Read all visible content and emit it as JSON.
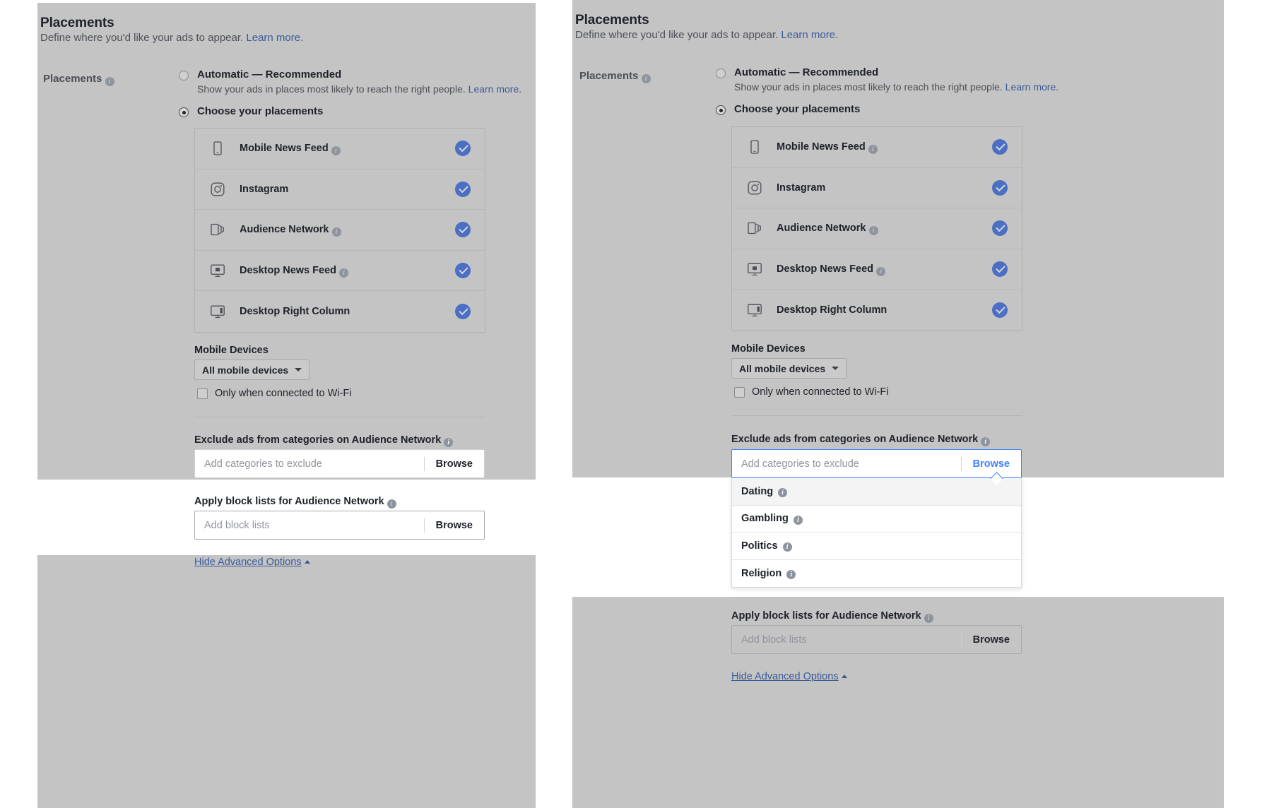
{
  "panels": [
    {
      "id": "left",
      "header": {
        "title": "Placements",
        "subtitle_prefix": "Define where you'd like your ads to appear. ",
        "subtitle_link": "Learn more",
        "subtitle_suffix": "."
      },
      "side_label": "Placements",
      "options": {
        "automatic": {
          "title": "Automatic — Recommended",
          "desc_prefix": "Show your ads in places most likely to reach the right people. ",
          "desc_link": "Learn more",
          "desc_suffix": ".",
          "selected": false
        },
        "choose": {
          "title": "Choose your placements",
          "selected": true
        }
      },
      "placements": [
        {
          "label": "Mobile News Feed",
          "icon": "mobile-phone-icon",
          "info": true,
          "checked": true
        },
        {
          "label": "Instagram",
          "icon": "instagram-icon",
          "info": false,
          "checked": true
        },
        {
          "label": "Audience Network",
          "icon": "audience-network-icon",
          "info": true,
          "checked": true
        },
        {
          "label": "Desktop News Feed",
          "icon": "desktop-monitor-icon",
          "info": true,
          "checked": true
        },
        {
          "label": "Desktop Right Column",
          "icon": "desktop-right-column-icon",
          "info": false,
          "checked": true
        }
      ],
      "mobile_devices": {
        "title": "Mobile Devices",
        "select_value": "All mobile devices",
        "wifi_label": "Only when connected to Wi-Fi",
        "wifi_checked": false
      },
      "exclude": {
        "title": "Exclude ads from categories on Audience Network",
        "placeholder": "Add categories to exclude",
        "value": "",
        "browse_label": "Browse",
        "focused": false,
        "menu_open": false
      },
      "block_lists": {
        "title": "Apply block lists for Audience Network",
        "placeholder": "Add block lists",
        "value": "",
        "browse_label": "Browse"
      },
      "advanced_link": "Hide Advanced Options"
    },
    {
      "id": "right",
      "header": {
        "title": "Placements",
        "subtitle_prefix": "Define where you'd like your ads to appear. ",
        "subtitle_link": "Learn more",
        "subtitle_suffix": "."
      },
      "side_label": "Placements",
      "options": {
        "automatic": {
          "title": "Automatic — Recommended",
          "desc_prefix": "Show your ads in places most likely to reach the right people. ",
          "desc_link": "Learn more",
          "desc_suffix": ".",
          "selected": false
        },
        "choose": {
          "title": "Choose your placements",
          "selected": true
        }
      },
      "placements": [
        {
          "label": "Mobile News Feed",
          "icon": "mobile-phone-icon",
          "info": true,
          "checked": true
        },
        {
          "label": "Instagram",
          "icon": "instagram-icon",
          "info": false,
          "checked": true
        },
        {
          "label": "Audience Network",
          "icon": "audience-network-icon",
          "info": true,
          "checked": true
        },
        {
          "label": "Desktop News Feed",
          "icon": "desktop-monitor-icon",
          "info": true,
          "checked": true
        },
        {
          "label": "Desktop Right Column",
          "icon": "desktop-right-column-icon",
          "info": false,
          "checked": true
        }
      ],
      "mobile_devices": {
        "title": "Mobile Devices",
        "select_value": "All mobile devices",
        "wifi_label": "Only when connected to Wi-Fi",
        "wifi_checked": false
      },
      "exclude": {
        "title": "Exclude ads from categories on Audience Network",
        "placeholder": "Add categories to exclude",
        "value": "",
        "browse_label": "Browse",
        "focused": true,
        "menu_open": true,
        "menu_items": [
          {
            "label": "Dating",
            "info": true,
            "highlighted": true
          },
          {
            "label": "Gambling",
            "info": true,
            "highlighted": false
          },
          {
            "label": "Politics",
            "info": true,
            "highlighted": false
          },
          {
            "label": "Religion",
            "info": true,
            "highlighted": false
          }
        ]
      },
      "block_lists": {
        "title": "Apply block lists for Audience Network",
        "placeholder": "Add block lists",
        "value": "",
        "browse_label": "Browse"
      },
      "advanced_link": "Hide Advanced Options"
    }
  ],
  "colors": {
    "panel_bg": "#c4c4c4",
    "accent_blue": "#4267B2",
    "check_blue": "#4a6fc4",
    "focus_blue": "#4080ff",
    "link": "#3b5998",
    "text": "#1d2129",
    "muted": "#4b4f56",
    "placeholder": "#90949c"
  }
}
